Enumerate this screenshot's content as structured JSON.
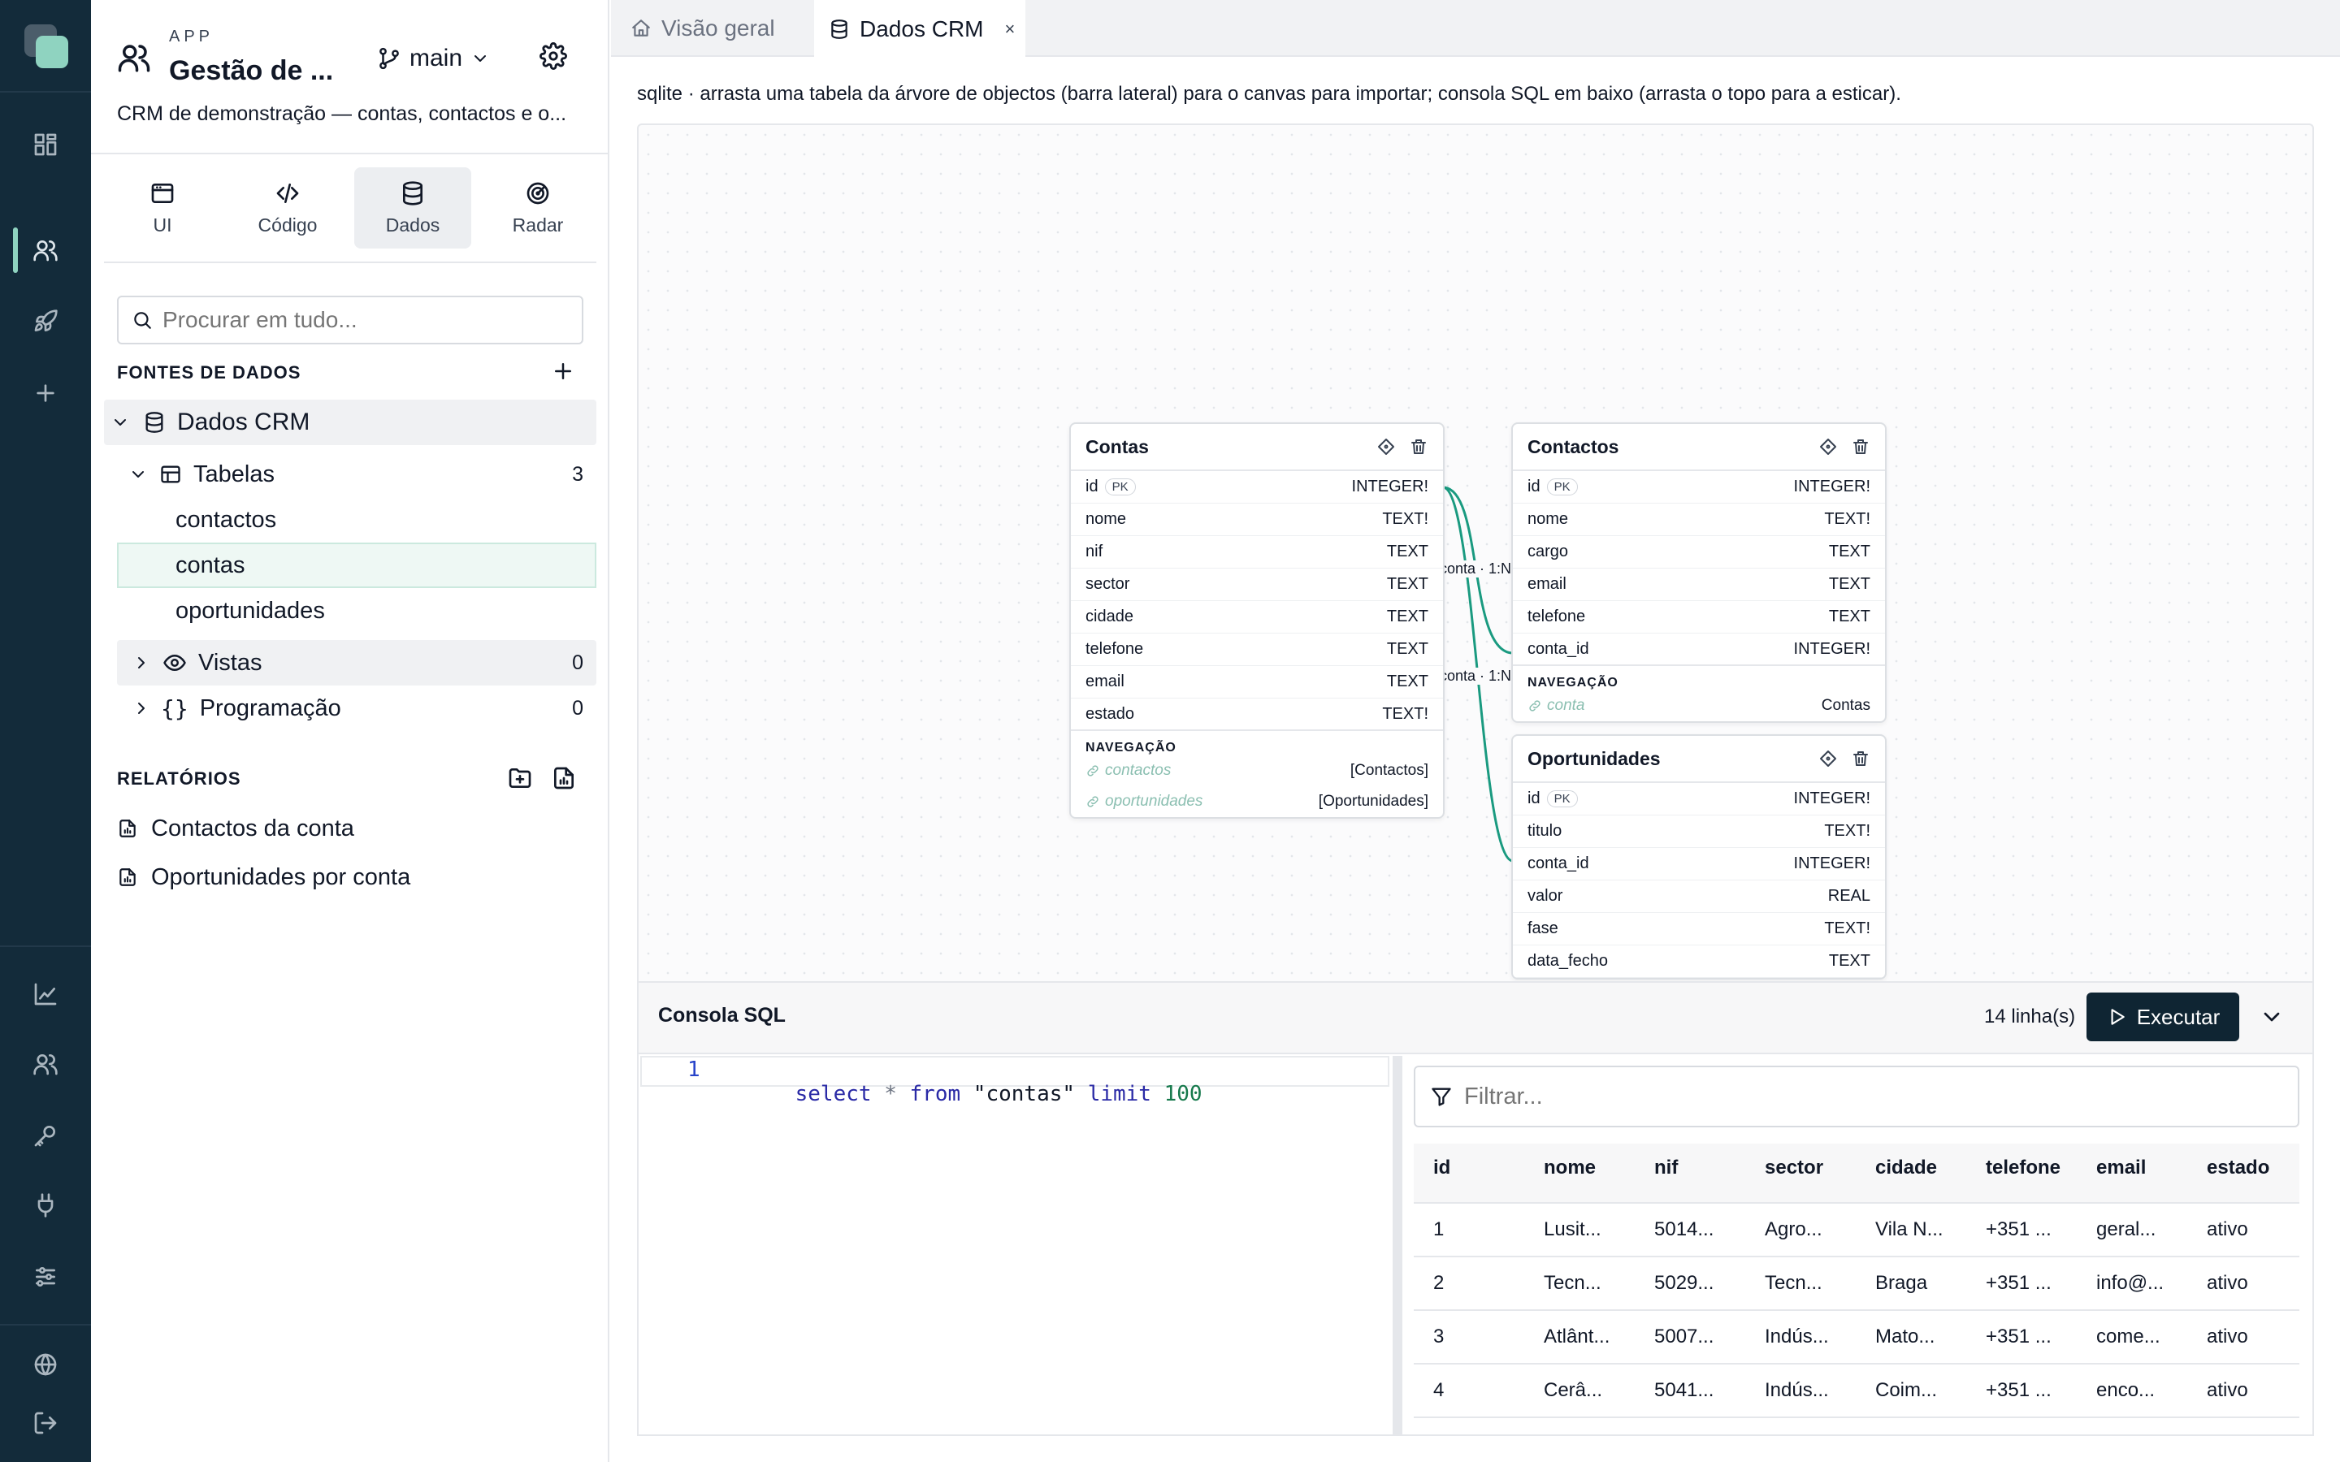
{
  "sidebar": {
    "app_label": "APP",
    "app_name": "Gestão de ...",
    "branch": "main",
    "description": "CRM de demonstração — contas, contactos e o...",
    "modes": [
      {
        "label": "UI"
      },
      {
        "label": "Código"
      },
      {
        "label": "Dados"
      },
      {
        "label": "Radar"
      }
    ],
    "search_placeholder": "Procurar em tudo...",
    "data_sources_title": "FONTES DE DADOS",
    "datasource_name": "Dados CRM",
    "tables_label": "Tabelas",
    "tables_count": "3",
    "tables": [
      "contactos",
      "contas",
      "oportunidades"
    ],
    "views_label": "Vistas",
    "views_count": "0",
    "programming_label": "Programação",
    "programming_count": "0",
    "reports_title": "RELATÓRIOS",
    "reports": [
      "Contactos da conta",
      "Oportunidades por conta"
    ]
  },
  "tabs": [
    {
      "label": "Visão geral",
      "active": false
    },
    {
      "label": "Dados CRM",
      "active": true
    }
  ],
  "hint": "sqlite · arrasta uma tabela da árvore de objectos (barra lateral) para o canvas para importar; consola SQL em baixo (arrasta o topo para a esticar).",
  "diagram": {
    "relation_label": "conta · 1:N",
    "navigation_label": "NAVEGAÇÃO",
    "pk_label": "PK",
    "contas": {
      "title": "Contas",
      "fields": [
        {
          "name": "id",
          "type": "INTEGER!"
        },
        {
          "name": "nome",
          "type": "TEXT!"
        },
        {
          "name": "nif",
          "type": "TEXT"
        },
        {
          "name": "sector",
          "type": "TEXT"
        },
        {
          "name": "cidade",
          "type": "TEXT"
        },
        {
          "name": "telefone",
          "type": "TEXT"
        },
        {
          "name": "email",
          "type": "TEXT"
        },
        {
          "name": "estado",
          "type": "TEXT!"
        }
      ],
      "navigation": [
        {
          "name": "contactos",
          "target": "[Contactos]"
        },
        {
          "name": "oportunidades",
          "target": "[Oportunidades]"
        }
      ]
    },
    "contactos": {
      "title": "Contactos",
      "fields": [
        {
          "name": "id",
          "type": "INTEGER!"
        },
        {
          "name": "nome",
          "type": "TEXT!"
        },
        {
          "name": "cargo",
          "type": "TEXT"
        },
        {
          "name": "email",
          "type": "TEXT"
        },
        {
          "name": "telefone",
          "type": "TEXT"
        },
        {
          "name": "conta_id",
          "type": "INTEGER!"
        }
      ],
      "navigation": [
        {
          "name": "conta",
          "target": "Contas"
        }
      ]
    },
    "oportunidades": {
      "title": "Oportunidades",
      "fields": [
        {
          "name": "id",
          "type": "INTEGER!"
        },
        {
          "name": "titulo",
          "type": "TEXT!"
        },
        {
          "name": "conta_id",
          "type": "INTEGER!"
        },
        {
          "name": "valor",
          "type": "REAL"
        },
        {
          "name": "fase",
          "type": "TEXT!"
        },
        {
          "name": "data_fecho",
          "type": "TEXT"
        }
      ]
    }
  },
  "console": {
    "title": "Consola SQL",
    "row_count": "14 linha(s)",
    "run_label": "Executar",
    "line_number": "1",
    "sql": {
      "kw1": "select",
      "star": "*",
      "kw2": "from",
      "table": "\"contas\"",
      "kw3": "limit",
      "num": "100"
    },
    "filter_placeholder": "Filtrar...",
    "columns": [
      "id",
      "nome",
      "nif",
      "sector",
      "cidade",
      "telefone",
      "email",
      "estado"
    ],
    "rows": [
      [
        "1",
        "Lusit...",
        "5014...",
        "Agro...",
        "Vila N...",
        "+351 ...",
        "geral...",
        "ativo"
      ],
      [
        "2",
        "Tecn...",
        "5029...",
        "Tecn...",
        "Braga",
        "+351 ...",
        "info@...",
        "ativo"
      ],
      [
        "3",
        "Atlânt...",
        "5007...",
        "Indús...",
        "Mato...",
        "+351 ...",
        "come...",
        "ativo"
      ],
      [
        "4",
        "Cerâ...",
        "5041...",
        "Indús...",
        "Coim...",
        "+351 ...",
        "enco...",
        "ativo"
      ]
    ]
  },
  "colors": {
    "rail": "#132b3a",
    "accent": "#0f8c72",
    "run_button": "#0f2533"
  }
}
